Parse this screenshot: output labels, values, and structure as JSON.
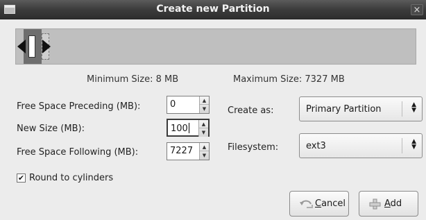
{
  "window": {
    "title": "Create new Partition",
    "close_glyph": "×",
    "menu_icon": "window-menu-icon"
  },
  "resizer": {
    "min_label": "Minimum Size: 8 MB",
    "max_label": "Maximum Size: 7327 MB"
  },
  "fields": {
    "preceding": {
      "label": "Free Space Preceding (MB):",
      "value": "0"
    },
    "new_size": {
      "label": "New Size (MB):",
      "value": "100"
    },
    "following": {
      "label": "Free Space Following (MB):",
      "value": "7227"
    }
  },
  "create_as": {
    "label": "Create as:",
    "value": "Primary Partition"
  },
  "filesystem": {
    "label": "Filesystem:",
    "value": "ext3"
  },
  "round": {
    "label": "Round to cylinders",
    "checked": true,
    "mark": "✔"
  },
  "buttons": {
    "cancel": {
      "mnemonic": "C",
      "rest": "ancel",
      "icon": "cancel-icon"
    },
    "add": {
      "mnemonic": "A",
      "rest": "dd",
      "icon": "add-icon"
    }
  },
  "spin_glyphs": {
    "up": "▲",
    "down": "▼"
  },
  "combo_glyphs": {
    "up": "▲",
    "down": "▼"
  }
}
